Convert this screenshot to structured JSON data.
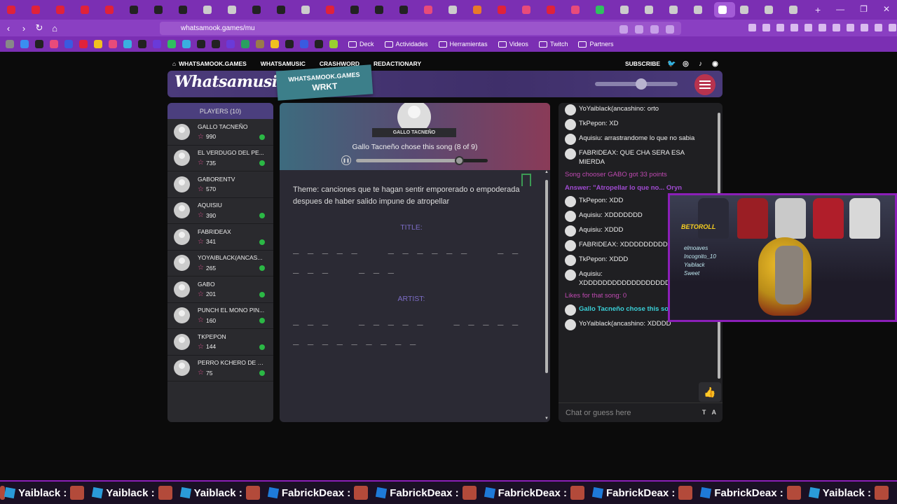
{
  "browser": {
    "url": "whatsamook.games/mu",
    "bookmarks": [
      "Deck",
      "Actividades",
      "Herramientas",
      "Videos",
      "Twitch",
      "Partners"
    ]
  },
  "topnav": {
    "home": "WHATSAMOOK.GAMES",
    "whatsamusic": "WHATSAMUSIC",
    "crashword": "CRASHWORD",
    "redactionary": "REDACTIONARY",
    "subscribe": "SUBSCRIBE"
  },
  "header": {
    "logo": "Whatsamusic",
    "ribbon_line1": "WHATSAMOOK.GAMES",
    "ribbon_line2": "WRKT"
  },
  "players": {
    "title": "PLAYERS (10)",
    "list": [
      {
        "name": "GALLO TACNEÑO",
        "score": "990",
        "online": true
      },
      {
        "name": "EL VERDUGO DEL PE...",
        "score": "735",
        "online": true
      },
      {
        "name": "GABORENTV",
        "score": "570",
        "online": false
      },
      {
        "name": "AQUISIU",
        "score": "390",
        "online": true
      },
      {
        "name": "FABRIDEAX",
        "score": "341",
        "online": true
      },
      {
        "name": "YOYAIBLACK(ANCAS...",
        "score": "265",
        "online": true
      },
      {
        "name": "GABO",
        "score": "201",
        "online": true
      },
      {
        "name": "PUNCH EL MONO PIN...",
        "score": "160",
        "online": true
      },
      {
        "name": "TKPEPON",
        "score": "144",
        "online": true
      },
      {
        "name": "PERRO KCHERO DE G...",
        "score": "75",
        "online": true
      }
    ]
  },
  "main": {
    "chooser_name": "GALLO TACNEÑO",
    "chose_text": "Gallo Tacneño chose this song (8 of 9)",
    "progress": 0.78,
    "theme": "Theme: canciones que te hagan sentir emporerado o empoderada despues de haber salido impune de atropellar",
    "title_label": "TITLE:",
    "title_blanks": "_ _ _ _ _    _ _ _ _ _ _    _ _\n_ _ _    _ _ _",
    "artist_label": "ARTIST:",
    "artist_blanks": "_ _ _    _ _ _ _ _    _ _ _ _ _\n_ _ _ _ _ _ _ _ _"
  },
  "chat": {
    "messages": [
      {
        "type": "user",
        "text": "YoYaiblack(ancashino: orto"
      },
      {
        "type": "user",
        "text": "TkPepon: XD"
      },
      {
        "type": "user",
        "text": "Aquisiu: arrastrandome lo que no sabia"
      },
      {
        "type": "user",
        "text": "FABRIDEAX: QUE CHA SERA ESA MIERDA"
      },
      {
        "type": "sys",
        "text": "Song chooser GABO got 33 points"
      },
      {
        "type": "ans",
        "text": "Answer: \"Atropellar lo que no... Oryn"
      },
      {
        "type": "user",
        "text": "TkPepon: XDD"
      },
      {
        "type": "user",
        "text": "Aquisiu: XDDDDDDD"
      },
      {
        "type": "user",
        "text": "Aquisiu: XDDD"
      },
      {
        "type": "user",
        "text": "FABRIDEAX: XDDDDDDDDDDDDDDDDD"
      },
      {
        "type": "user",
        "text": "TkPepon: XDDD"
      },
      {
        "type": "user",
        "text": "Aquisiu: XDDDDDDDDDDDDDDDDDDDDDDDDDD"
      },
      {
        "type": "sys",
        "text": "Likes for that song: 0"
      },
      {
        "type": "cyan",
        "text": "Gallo Tacneño chose this song! (8 of 9)"
      },
      {
        "type": "user",
        "text": "YoYaiblack(ancashino: XDDDD"
      }
    ],
    "input_placeholder": "Chat or guess here",
    "input_tools": "T A"
  },
  "webcam": {
    "logo": "BETOROLL",
    "names": [
      "elmoaves",
      "Incognito_10",
      "Yaiblack",
      "Sweet"
    ]
  },
  "ticker": {
    "items": [
      {
        "icon": "cube",
        "name": "Yaiblack :"
      },
      {
        "icon": "cube",
        "name": "Yaiblack :"
      },
      {
        "icon": "cube",
        "name": "Yaiblack :"
      },
      {
        "icon": "x",
        "name": "FabrickDeax :"
      },
      {
        "icon": "x",
        "name": "FabrickDeax :"
      },
      {
        "icon": "x",
        "name": "FabrickDeax :"
      },
      {
        "icon": "x",
        "name": "FabrickDeax :"
      },
      {
        "icon": "x",
        "name": "FabrickDeax :"
      },
      {
        "icon": "cube",
        "name": "Yaiblack :"
      }
    ]
  },
  "colors": {
    "accent": "#7b2fb3",
    "online": "#2bb845",
    "star": "#d94e8a",
    "label": "#7c6cc5"
  }
}
